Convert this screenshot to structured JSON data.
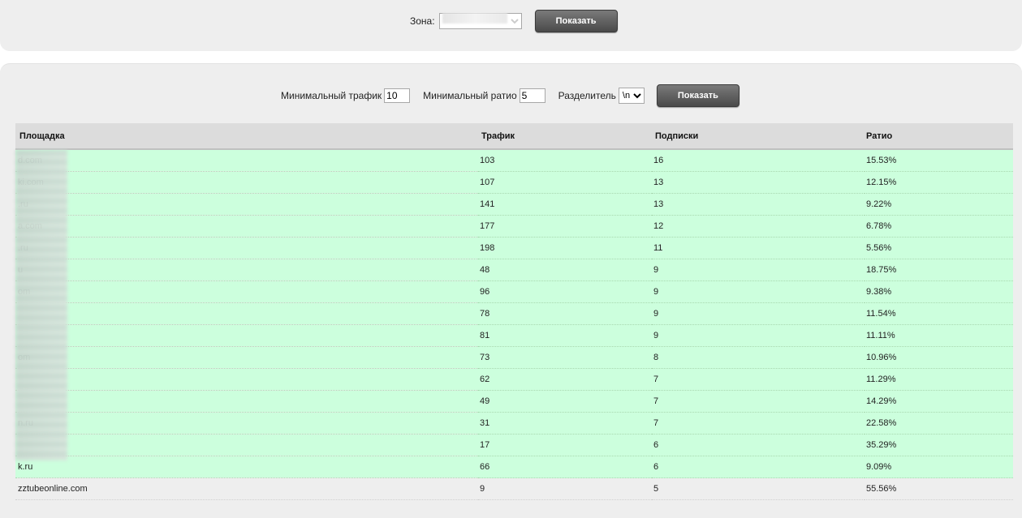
{
  "zone_form": {
    "label": "Зона:",
    "selected": "'",
    "button_label": "Показать"
  },
  "filter_form": {
    "min_traffic_label": "Минимальный трафик",
    "min_traffic_value": "10",
    "min_ratio_label": "Минимальный ратио",
    "min_ratio_value": "5",
    "separator_label": "Разделитель",
    "separator_value": "\\n",
    "button_label": "Показать"
  },
  "table": {
    "headers": [
      "Площадка",
      "Трафик",
      "Подписки",
      "Ратио"
    ],
    "rows": [
      {
        "site": "d.com",
        "traffic": "103",
        "subs": "16",
        "ratio": "15.53%",
        "highlight": true
      },
      {
        "site": "ki.com",
        "traffic": "107",
        "subs": "13",
        "ratio": "12.15%",
        "highlight": true
      },
      {
        "site": ".ru",
        "traffic": "141",
        "subs": "13",
        "ratio": "9.22%",
        "highlight": true
      },
      {
        "site": "a.com",
        "traffic": "177",
        "subs": "12",
        "ratio": "6.78%",
        "highlight": true
      },
      {
        "site": ".ru",
        "traffic": "198",
        "subs": "11",
        "ratio": "5.56%",
        "highlight": true
      },
      {
        "site": "u",
        "traffic": "48",
        "subs": "9",
        "ratio": "18.75%",
        "highlight": true
      },
      {
        "site": "om",
        "traffic": "96",
        "subs": "9",
        "ratio": "9.38%",
        "highlight": true
      },
      {
        "site": "",
        "traffic": "78",
        "subs": "9",
        "ratio": "11.54%",
        "highlight": true
      },
      {
        "site": "",
        "traffic": "81",
        "subs": "9",
        "ratio": "11.11%",
        "highlight": true
      },
      {
        "site": "om",
        "traffic": "73",
        "subs": "8",
        "ratio": "10.96%",
        "highlight": true
      },
      {
        "site": "",
        "traffic": "62",
        "subs": "7",
        "ratio": "11.29%",
        "highlight": true
      },
      {
        "site": "",
        "traffic": "49",
        "subs": "7",
        "ratio": "14.29%",
        "highlight": true
      },
      {
        "site": "n.ru",
        "traffic": "31",
        "subs": "7",
        "ratio": "22.58%",
        "highlight": true
      },
      {
        "site": "",
        "traffic": "17",
        "subs": "6",
        "ratio": "35.29%",
        "highlight": true
      },
      {
        "site": "k.ru",
        "traffic": "66",
        "subs": "6",
        "ratio": "9.09%",
        "highlight": true
      },
      {
        "site": "zztubeonline.com",
        "traffic": "9",
        "subs": "5",
        "ratio": "55.56%",
        "highlight": false
      }
    ]
  },
  "colors": {
    "highlight_row": "#ccffdd",
    "panel_bg": "#eeeeee",
    "header_bg": "#dcdcdc",
    "button_bg": "#5a5a5a"
  }
}
